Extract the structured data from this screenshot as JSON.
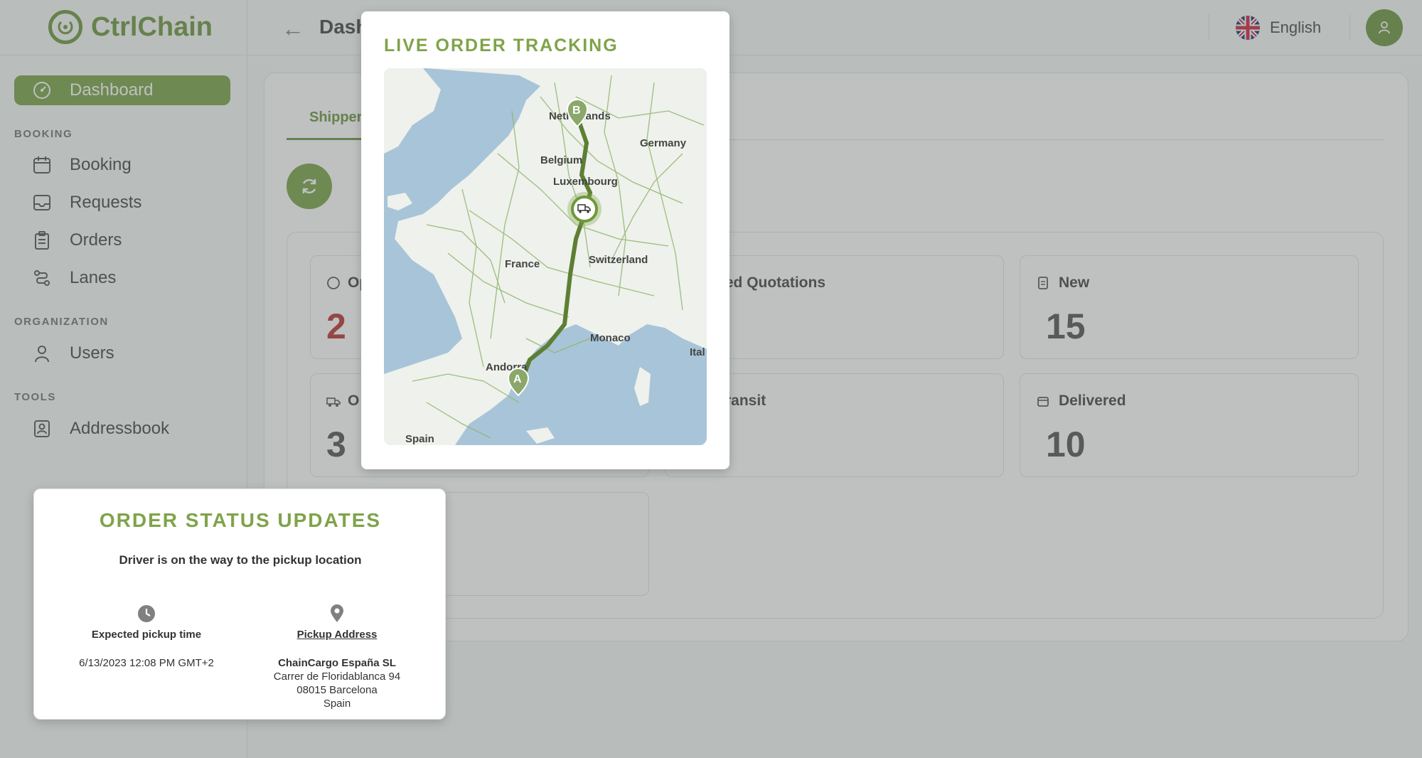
{
  "app": {
    "name": "CtrlChain",
    "page_title": "Dashboard"
  },
  "header": {
    "language": "English"
  },
  "sidebar": {
    "dashboard": "Dashboard",
    "sections": {
      "booking": "BOOKING",
      "organization": "ORGANIZATION",
      "tools": "TOOLS"
    },
    "items": {
      "booking": "Booking",
      "requests": "Requests",
      "orders": "Orders",
      "lanes": "Lanes",
      "users": "Users",
      "addressbook": "Addressbook"
    }
  },
  "main": {
    "tab_shipper": "Shipper",
    "stats": {
      "open_label": "Op",
      "open_value": "2",
      "offered_label": "ered Quotations",
      "new_label": "New",
      "new_value": "15",
      "ongoing_label": "O",
      "ongoing_value": "3",
      "transit_label": "ransit",
      "delivered_label": "Delivered",
      "delivered_value": "10"
    }
  },
  "map_modal": {
    "title": "LIVE ORDER TRACKING",
    "labels": {
      "netherlands": "Netherlands",
      "germany": "Germany",
      "belgium": "Belgium",
      "luxembourg": "Luxembourg",
      "france": "France",
      "switzerland": "Switzerland",
      "monaco": "Monaco",
      "andorra": "Andorra",
      "italy": "Ital",
      "spain": "Spain",
      "marker_a": "A",
      "marker_b": "B"
    }
  },
  "status_card": {
    "title": "ORDER STATUS UPDATES",
    "message": "Driver is on the way to the pickup location",
    "pickup_time_label": "Expected pickup time",
    "pickup_time_value": "6/13/2023 12:08 PM GMT+2",
    "pickup_address_label": "Pickup Address",
    "address": {
      "company": "ChainCargo España SL",
      "street": "Carrer de Floridablanca 94",
      "city": "08015 Barcelona",
      "country": "Spain"
    }
  },
  "colors": {
    "brand": "#5f8a2f",
    "accent": "#7fa34a",
    "alert": "#b5221f"
  }
}
